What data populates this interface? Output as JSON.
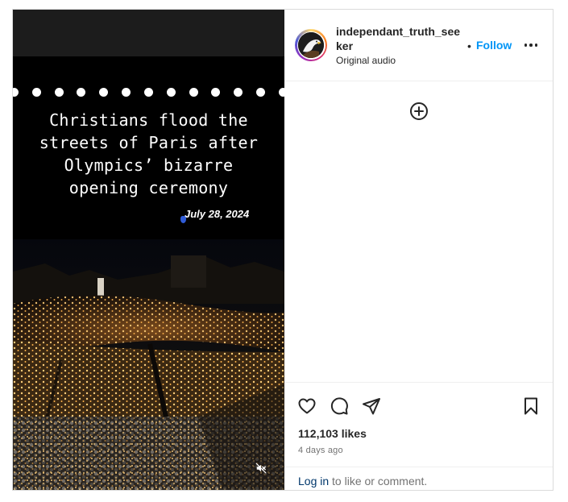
{
  "post": {
    "headline": "Christians flood the\nstreets of Paris after\nOlympics’ bizarre\nopening ceremony",
    "date_overlay": "July 28, 2024"
  },
  "header": {
    "username": "independant_truth_seeker",
    "audio": "Original audio",
    "separator": "•",
    "follow_label": "Follow"
  },
  "actions": {
    "likes": "112,103 likes",
    "time_ago": "4 days ago"
  },
  "footer": {
    "login_label": "Log in",
    "rest": " to like or comment."
  },
  "icons": {
    "like": "heart-icon",
    "comment": "comment-icon",
    "share": "share-icon",
    "save": "bookmark-icon",
    "more": "more-horizontal-icon",
    "add": "add-circle-icon",
    "mute": "muted-speaker-icon"
  },
  "colors": {
    "accent": "#0095f6",
    "link": "#00376b",
    "muted_text": "#737373"
  }
}
